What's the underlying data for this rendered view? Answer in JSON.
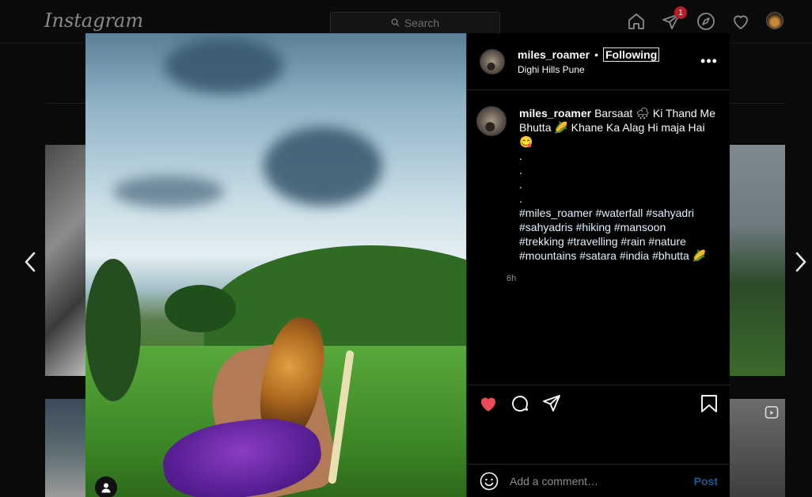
{
  "app": {
    "logo": "Instagram"
  },
  "topnav": {
    "search_placeholder": "Search",
    "notification_count": "1",
    "icons": [
      "home-icon",
      "direct-icon",
      "explore-icon",
      "activity-icon",
      "profile-avatar"
    ]
  },
  "post": {
    "username": "miles_roamer",
    "separator": "•",
    "follow_label": "Following",
    "location": "Dighi Hills Pune",
    "more_label": "•••",
    "caption_lines": [
      "Barsaat 🌧 Ki Thand Me",
      "Bhutta 🌽 Khane Ka Alag Hi maja Hai",
      "😋",
      ".",
      ".",
      ".",
      "."
    ],
    "hashtag_lines": [
      "#miles_roamer #waterfall #sahyadri",
      "#sahyadris #hiking #mansoon",
      "#trekking #travelling #rain #nature",
      "#mountains #satara #india #bhutta 🌽"
    ],
    "time_ago": "6h",
    "liked": true,
    "comment_placeholder": "Add a comment…",
    "post_label": "Post"
  },
  "colors": {
    "like": "#ed4956",
    "post_button": "#1d5a8a",
    "badge": "#b61f2a"
  }
}
